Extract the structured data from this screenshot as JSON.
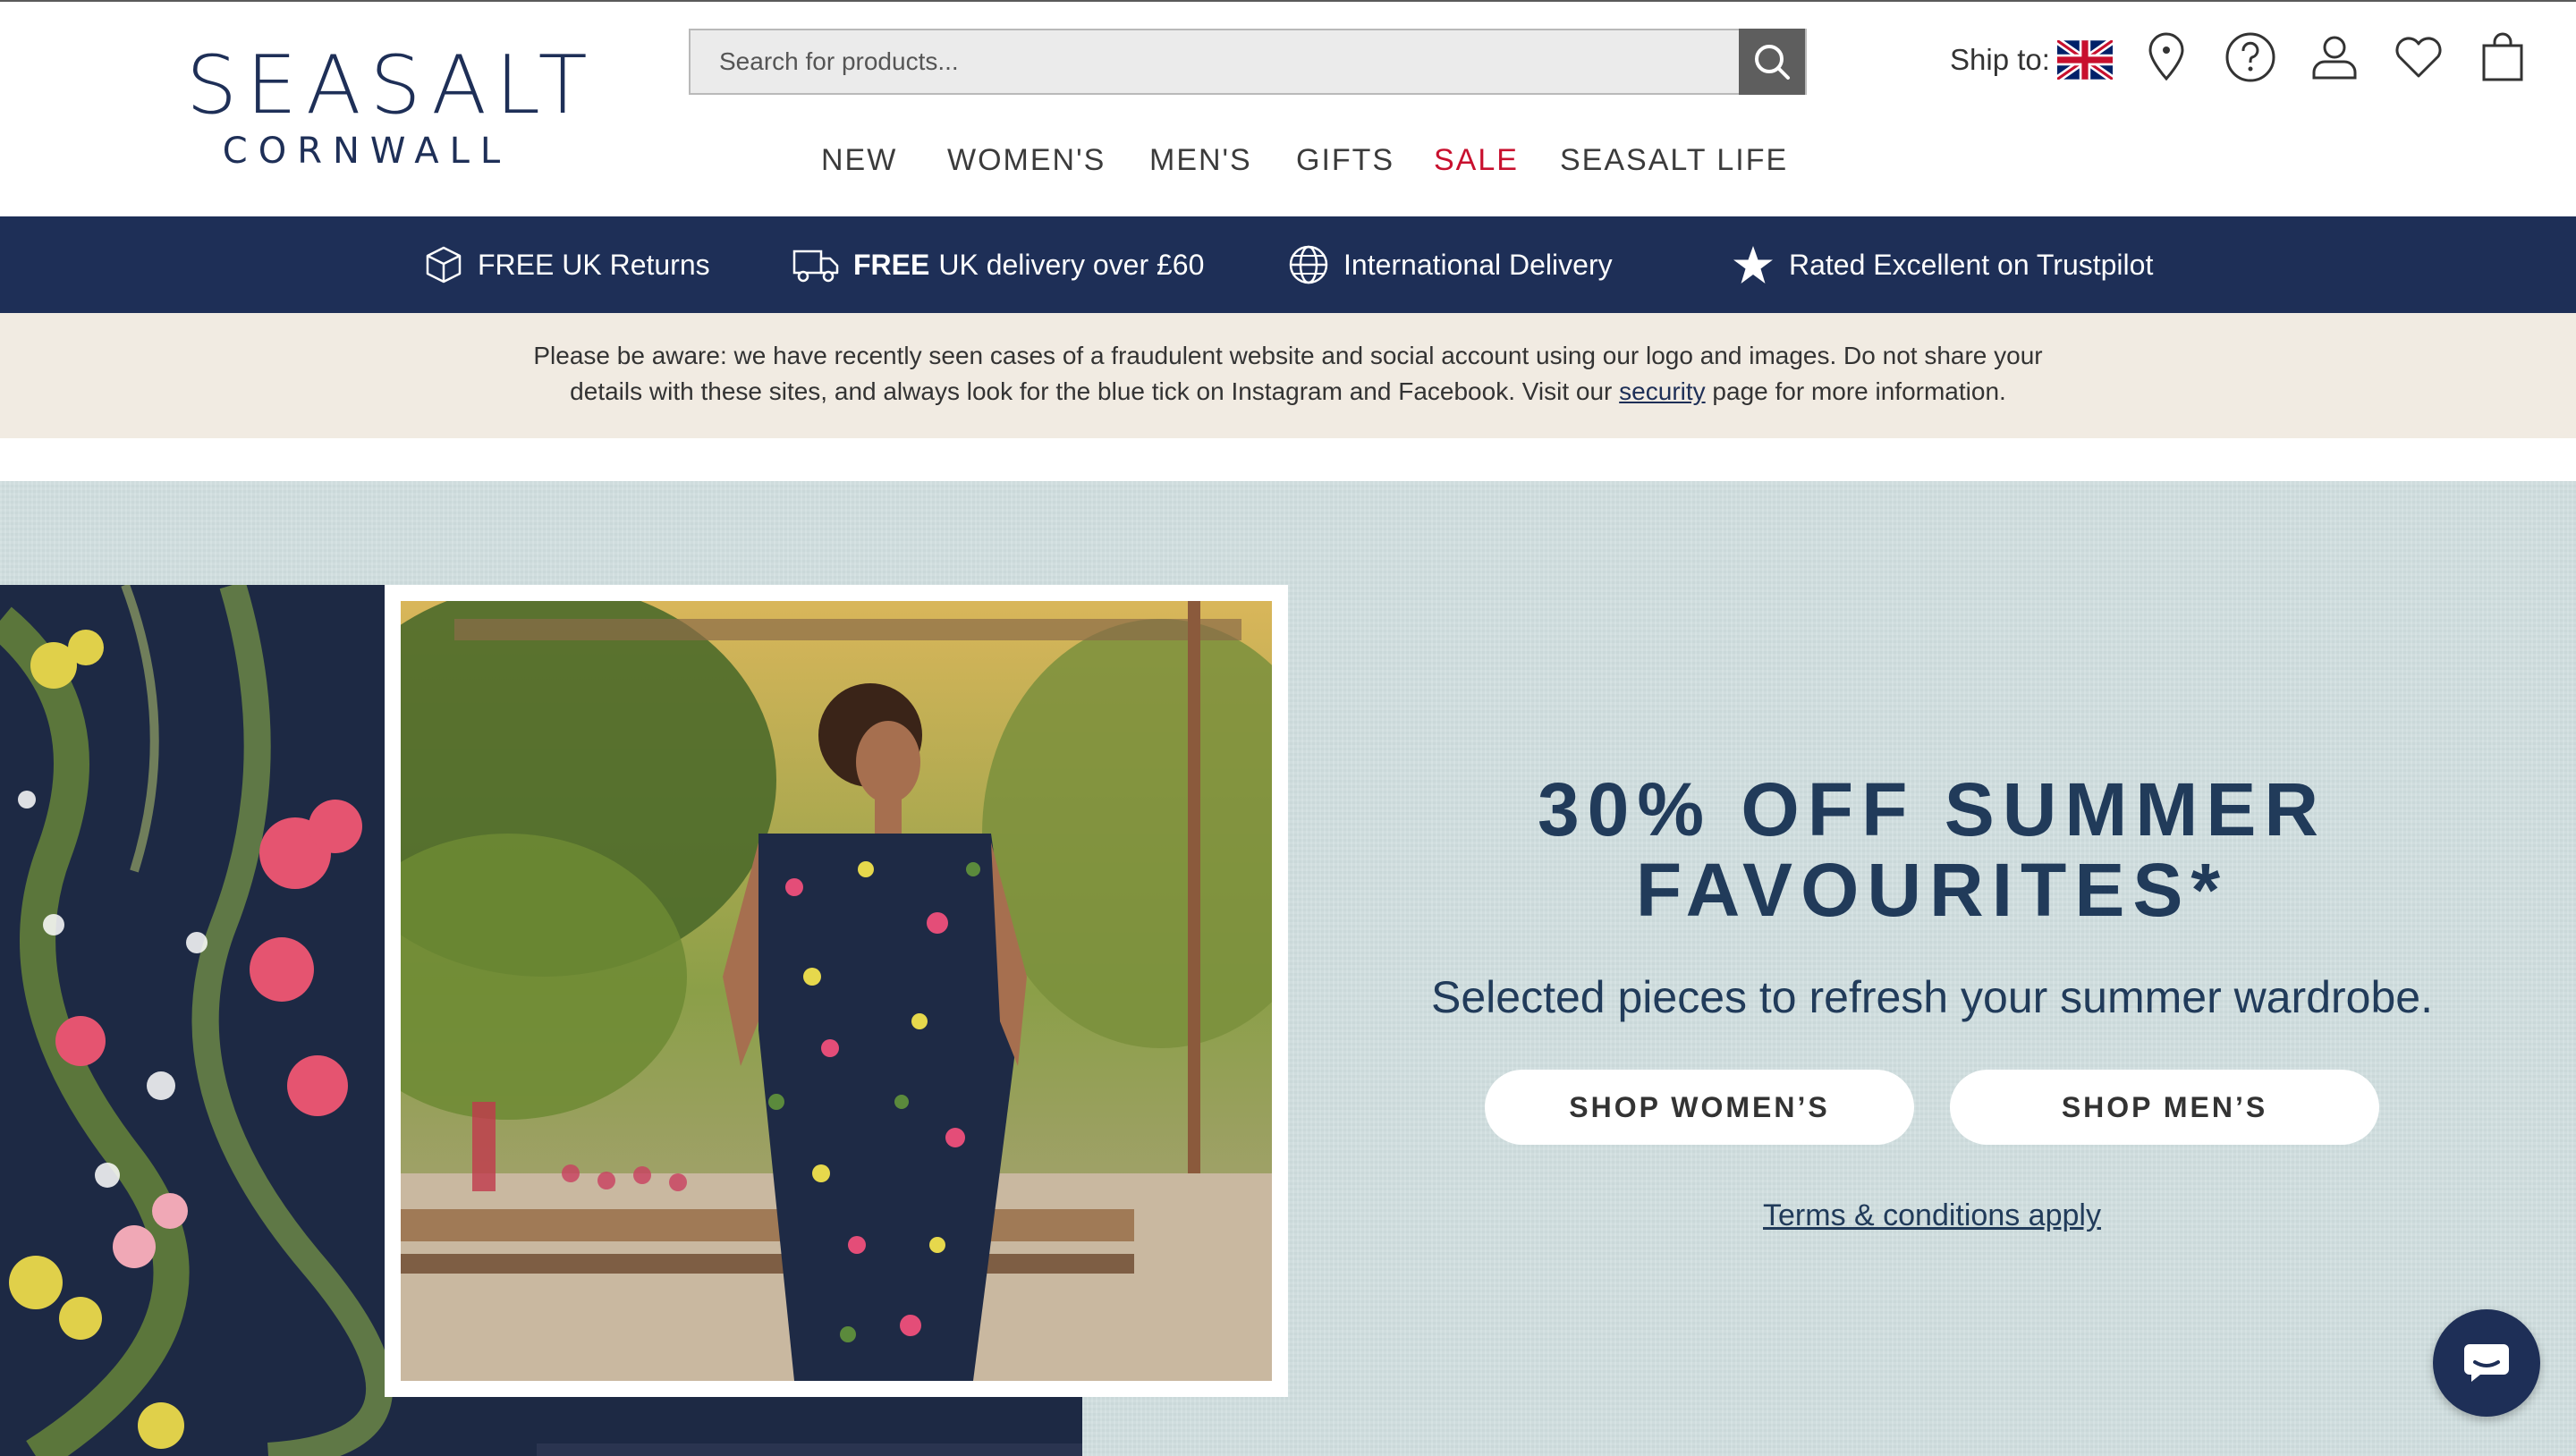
{
  "brand": {
    "name": "SEASALT",
    "subname": "CORNWALL"
  },
  "search": {
    "placeholder": "Search for products..."
  },
  "header": {
    "ship_to_label": "Ship to:"
  },
  "nav": {
    "items": [
      {
        "label": "NEW"
      },
      {
        "label": "WOMEN'S"
      },
      {
        "label": "MEN'S"
      },
      {
        "label": "GIFTS"
      },
      {
        "label": "SALE"
      },
      {
        "label": "SEASALT LIFE"
      }
    ]
  },
  "usp": {
    "returns": "FREE UK Returns",
    "delivery_bold": "FREE",
    "delivery_rest": "UK delivery over £60",
    "international": "International Delivery",
    "trustpilot": "Rated Excellent on Trustpilot"
  },
  "notice": {
    "line1": "Please be aware: we have recently seen cases of a fraudulent website and social account using our logo and images. Do not share your",
    "line2_before": "details with these sites, and always look for the blue tick on Instagram and Facebook. Visit our ",
    "link": "security",
    "line2_after": " page for more information."
  },
  "hero": {
    "title_line1": "30% OFF SUMMER",
    "title_line2": "FAVOURITES*",
    "subtitle": "Selected pieces to refresh your summer wardrobe.",
    "shop_womens": "SHOP WOMEN’S",
    "shop_mens": "SHOP MEN’S",
    "terms": "Terms & conditions apply"
  },
  "colors": {
    "navy": "#1e2f57",
    "sale_red": "#c8102e",
    "notice_bg": "#f1ebe2",
    "hero_bg": "#d2e0e1"
  },
  "icons": [
    "search-icon",
    "uk-flag-icon",
    "store-locator-icon",
    "help-icon",
    "account-icon",
    "wishlist-icon",
    "bag-icon",
    "box-icon",
    "truck-icon",
    "globe-icon",
    "star-icon",
    "chat-icon"
  ]
}
